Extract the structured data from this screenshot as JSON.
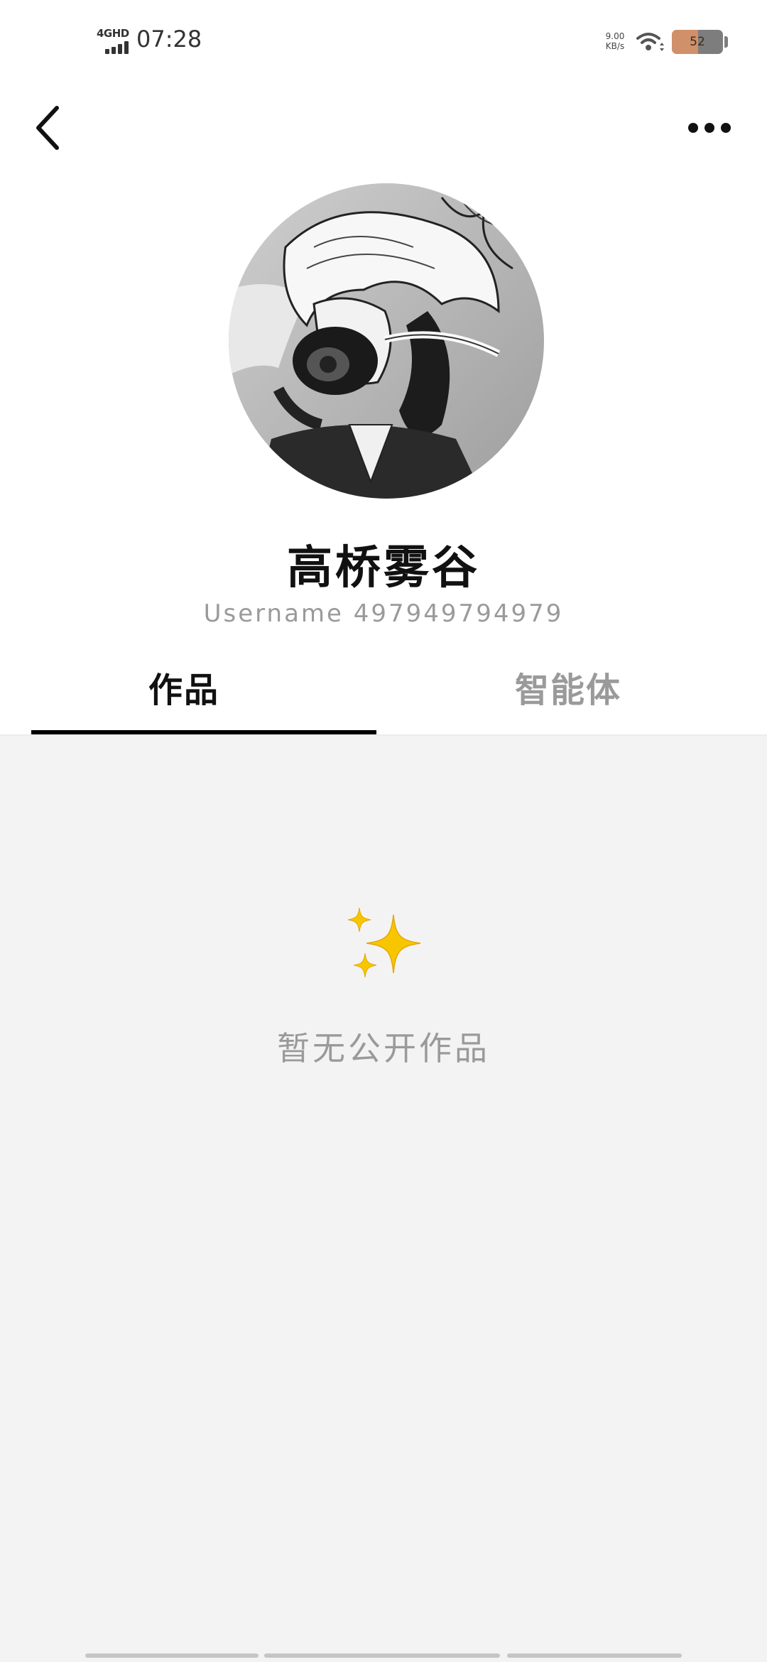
{
  "status_bar": {
    "network_type": "4GHD",
    "time": "07:28",
    "net_speed_value": "9.00",
    "net_speed_unit": "KB/s",
    "battery_level": "52",
    "battery_fraction": 0.52
  },
  "header": {
    "back_icon": "chevron-left-icon",
    "more_icon": "more-horizontal-icon"
  },
  "profile": {
    "avatar": "manga character wearing gas mask",
    "display_name": "高桥雾谷",
    "username": "Username 497949794979"
  },
  "tabs": [
    {
      "label": "作品",
      "active": true
    },
    {
      "label": "智能体",
      "active": false
    }
  ],
  "empty_state": {
    "icon": "sparkles-icon",
    "message": "暂无公开作品"
  },
  "colors": {
    "active_tab": "#111111",
    "inactive_tab": "#9a9a9a",
    "content_bg": "#f4f3f4",
    "sparkle": "#f5c400"
  }
}
